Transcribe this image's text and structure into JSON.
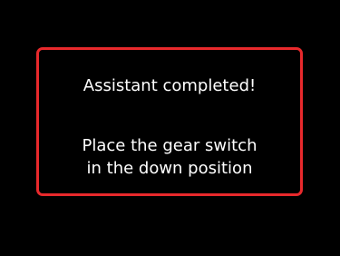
{
  "dialog": {
    "title": "Assistant completed!",
    "instruction_line_1": "Place the gear switch",
    "instruction_line_2": "in the down position"
  },
  "colors": {
    "background": "#000000",
    "border": "#e8292c",
    "text": "#ffffff"
  }
}
